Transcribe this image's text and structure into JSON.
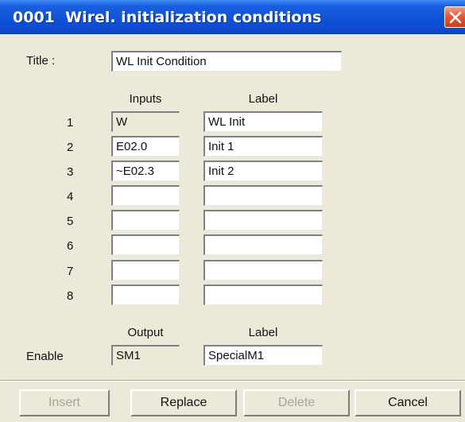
{
  "window": {
    "title": "0001  Wirel. initialization conditions"
  },
  "title_field": {
    "label": "Title :",
    "value": "WL Init Condition"
  },
  "headers": {
    "inputs": "Inputs",
    "label": "Label",
    "output": "Output",
    "output_label": "Label"
  },
  "rows": [
    {
      "num": "1",
      "input": "W",
      "label": "WL Init"
    },
    {
      "num": "2",
      "input": "E02.0",
      "label": "Init 1"
    },
    {
      "num": "3",
      "input": "~E02.3",
      "label": "Init 2"
    },
    {
      "num": "4",
      "input": "",
      "label": ""
    },
    {
      "num": "5",
      "input": "",
      "label": ""
    },
    {
      "num": "6",
      "input": "",
      "label": ""
    },
    {
      "num": "7",
      "input": "",
      "label": ""
    },
    {
      "num": "8",
      "input": "",
      "label": ""
    }
  ],
  "enable": {
    "label": "Enable",
    "output": "SM1",
    "output_label": "SpecialM1"
  },
  "buttons": {
    "insert": "Insert",
    "replace": "Replace",
    "delete": "Delete",
    "cancel": "Cancel"
  }
}
